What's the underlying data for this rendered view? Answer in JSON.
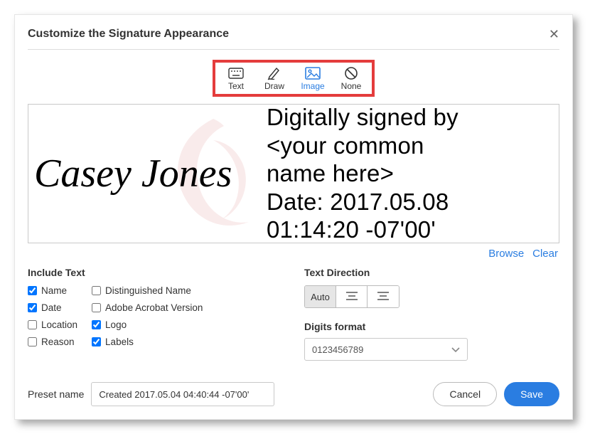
{
  "dialog": {
    "title": "Customize the Signature Appearance"
  },
  "modes": {
    "text": "Text",
    "draw": "Draw",
    "image": "Image",
    "none": "None"
  },
  "preview": {
    "signature_name": "Casey Jones",
    "details_line1": "Digitally signed by",
    "details_line2": "<your common",
    "details_line3": "name here>",
    "details_line4": "Date: 2017.05.08",
    "details_line5": "01:14:20 -07'00'"
  },
  "preview_actions": {
    "browse": "Browse",
    "clear": "Clear"
  },
  "include_text": {
    "heading": "Include Text",
    "name": "Name",
    "date": "Date",
    "location": "Location",
    "reason": "Reason",
    "distinguished": "Distinguished Name",
    "acrobat_version": "Adobe Acrobat Version",
    "logo": "Logo",
    "labels": "Labels"
  },
  "text_direction": {
    "heading": "Text Direction",
    "auto": "Auto"
  },
  "digits": {
    "heading": "Digits format",
    "value": "0123456789"
  },
  "preset": {
    "label": "Preset name",
    "value": "Created 2017.05.04 04:40:44 -07'00'"
  },
  "buttons": {
    "cancel": "Cancel",
    "save": "Save"
  }
}
